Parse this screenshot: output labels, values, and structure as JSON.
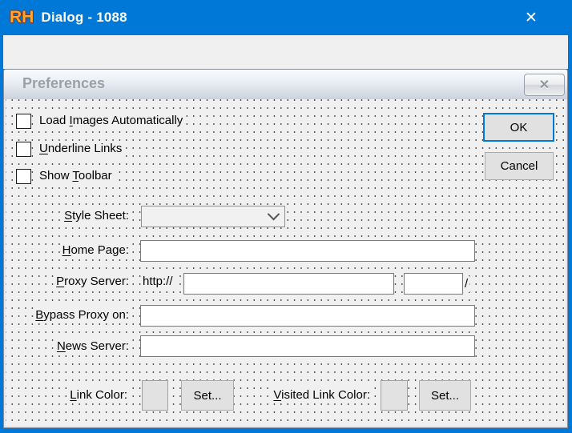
{
  "colors": {
    "accent": "#0078d7",
    "titlebar_bg": "#0078d7",
    "titlebar_text": "#ffffff",
    "client_bg": "#f0f0f0",
    "prefs_title_text": "#9aa0a8",
    "default_button_border": "#0078d7"
  },
  "window": {
    "logo": "RH",
    "title": "Dialog - 1088"
  },
  "icons": {
    "close": "✕",
    "combo_chevron": "chevron-down"
  },
  "prefs": {
    "title": "Preferences",
    "checkboxes": [
      {
        "pre": "Load ",
        "key": "I",
        "post": "mages Automatically",
        "checked": false
      },
      {
        "pre": "",
        "key": "U",
        "post": "nderline Links",
        "checked": false
      },
      {
        "pre": "Show ",
        "key": "T",
        "post": "oolbar",
        "checked": false
      }
    ],
    "rows": {
      "style_sheet": {
        "label": {
          "pre": "",
          "key": "S",
          "post": "tyle Sheet:"
        },
        "value": "",
        "placeholder": ""
      },
      "home_page": {
        "label": {
          "pre": "",
          "key": "H",
          "post": "ome Page:"
        },
        "value": "",
        "placeholder": ""
      },
      "proxy": {
        "label": {
          "pre": "",
          "key": "P",
          "post": "roxy Server:"
        },
        "prefix": "http://",
        "host": "",
        "port": "",
        "suffix": "/"
      },
      "bypass": {
        "label": {
          "pre": "",
          "key": "B",
          "post": "ypass Proxy on:"
        },
        "value": "",
        "placeholder": ""
      },
      "news": {
        "label": {
          "pre": "",
          "key": "N",
          "post": "ews Server:"
        },
        "value": "",
        "placeholder": ""
      }
    },
    "link_colors": {
      "link_label": {
        "pre": "",
        "key": "L",
        "post": "ink Color:"
      },
      "visited_label": {
        "pre": "",
        "key": "V",
        "post": "isited Link Color:"
      },
      "set_label": "Set...",
      "set_label2": "Set..."
    },
    "buttons": {
      "ok": "OK",
      "cancel": "Cancel"
    }
  }
}
